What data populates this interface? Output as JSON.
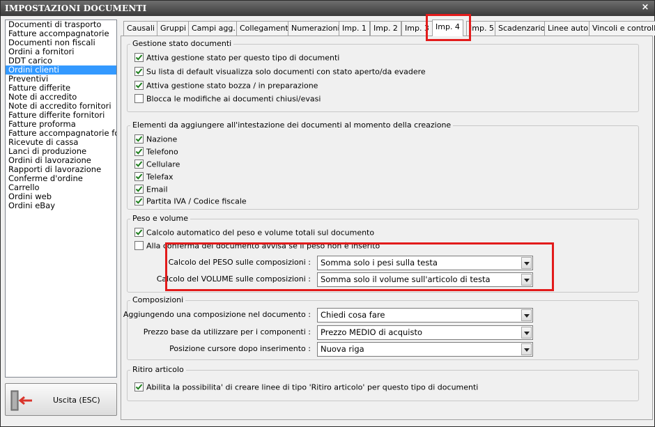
{
  "window": {
    "title": "IMPOSTAZIONI DOCUMENTI",
    "close_icon": "×"
  },
  "doc_types": [
    {
      "label": "Documenti di trasporto",
      "selected": false
    },
    {
      "label": "Fatture accompagnatorie",
      "selected": false
    },
    {
      "label": "Documenti non fiscali",
      "selected": false
    },
    {
      "label": "Ordini a fornitori",
      "selected": false
    },
    {
      "label": "DDT carico",
      "selected": false
    },
    {
      "label": "Ordini clienti",
      "selected": true
    },
    {
      "label": "Preventivi",
      "selected": false
    },
    {
      "label": "Fatture differite",
      "selected": false
    },
    {
      "label": "Note di accredito",
      "selected": false
    },
    {
      "label": "Note di accredito fornitori",
      "selected": false
    },
    {
      "label": "Fatture differite fornitori",
      "selected": false
    },
    {
      "label": "Fatture proforma",
      "selected": false
    },
    {
      "label": "Fatture accompagnatorie fo",
      "selected": false
    },
    {
      "label": "Ricevute di cassa",
      "selected": false
    },
    {
      "label": "Lanci di produzione",
      "selected": false
    },
    {
      "label": "Ordini di lavorazione",
      "selected": false
    },
    {
      "label": "Rapporti di lavorazione",
      "selected": false
    },
    {
      "label": "Conferme d'ordine",
      "selected": false
    },
    {
      "label": "Carrello",
      "selected": false
    },
    {
      "label": "Ordini web",
      "selected": false
    },
    {
      "label": "Ordini eBay",
      "selected": false
    }
  ],
  "exit_button": {
    "label": "Uscita (ESC)"
  },
  "tabs": [
    {
      "label": "Causali",
      "active": false
    },
    {
      "label": "Gruppi",
      "active": false
    },
    {
      "label": "Campi agg.",
      "active": false
    },
    {
      "label": "Collegamenti",
      "active": false
    },
    {
      "label": "Numerazioni",
      "active": false
    },
    {
      "label": "Imp. 1",
      "active": false
    },
    {
      "label": "Imp. 2",
      "active": false
    },
    {
      "label": "Imp. 3",
      "active": false
    },
    {
      "label": "Imp. 4",
      "active": true
    },
    {
      "label": "Imp. 5",
      "active": false
    },
    {
      "label": "Scadenzario",
      "active": false
    },
    {
      "label": "Linee auto",
      "active": false
    },
    {
      "label": "Vincoli e controlli",
      "active": false
    }
  ],
  "group_stato": {
    "title": "Gestione stato documenti",
    "options": [
      {
        "label": "Attiva gestione stato per questo tipo di documenti",
        "checked": true
      },
      {
        "label": "Su lista di default visualizza solo documenti con stato aperto/da evadere",
        "checked": true
      },
      {
        "label": "Attiva gestione stato bozza / in preparazione",
        "checked": true
      },
      {
        "label": "Blocca le modifiche ai documenti chiusi/evasi",
        "checked": false
      }
    ]
  },
  "group_intestazione": {
    "title": "Elementi da aggiungere all'intestazione dei documenti al momento della creazione",
    "options": [
      {
        "label": "Nazione",
        "checked": true
      },
      {
        "label": "Telefono",
        "checked": true
      },
      {
        "label": "Cellulare",
        "checked": true
      },
      {
        "label": "Telefax",
        "checked": true
      },
      {
        "label": "Email",
        "checked": true
      },
      {
        "label": "Partita IVA / Codice fiscale",
        "checked": true
      }
    ]
  },
  "group_peso": {
    "title": "Peso e volume",
    "options": [
      {
        "label": "Calcolo automatico del peso e volume totali sul documento",
        "checked": true
      },
      {
        "label": "Alla conferma del documento avvisa se il peso non è inserito",
        "checked": false
      }
    ],
    "fields": [
      {
        "label": "Calcolo del PESO sulle composizioni :",
        "value": "Somma solo i pesi sulla testa"
      },
      {
        "label": "Calcolo del VOLUME sulle composizioni :",
        "value": "Somma solo il volume sull'articolo di testa"
      }
    ]
  },
  "group_composizioni": {
    "title": "Composizioni",
    "fields": [
      {
        "label": "Aggiungendo una composizione nel documento :",
        "value": "Chiedi cosa fare"
      },
      {
        "label": "Prezzo base da utilizzare per i componenti :",
        "value": "Prezzo MEDIO di acquisto"
      },
      {
        "label": "Posizione cursore dopo inserimento :",
        "value": "Nuova riga"
      }
    ]
  },
  "group_ritiro": {
    "title": "Ritiro articolo",
    "options": [
      {
        "label": "Abilita la possibilita' di creare linee di tipo 'Ritiro articolo' per questo tipo di documenti",
        "checked": true
      }
    ]
  },
  "icons": {
    "exit": "door-exit-icon",
    "check": "check-icon",
    "dropdown": "chevron-down-icon"
  },
  "colors": {
    "selection": "#3399ff",
    "highlight_box": "#e21b1b",
    "exit_arrow": "#d9342b"
  }
}
